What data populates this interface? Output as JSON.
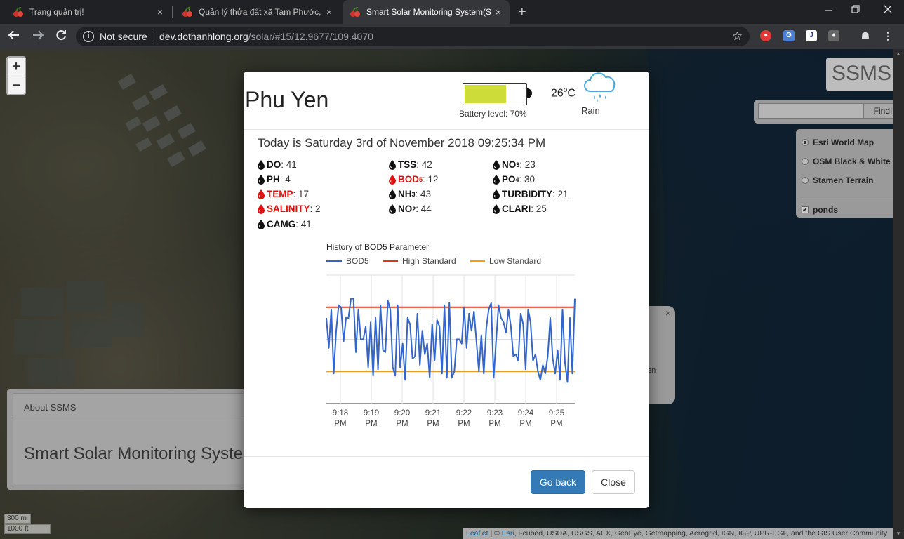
{
  "browser": {
    "tabs": [
      {
        "title": "Trang quản trị!"
      },
      {
        "title": "Quản lý thửa đất xã Tam Phước, I"
      },
      {
        "title": "Smart Solar Monitoring System(S"
      }
    ],
    "security": "Not secure",
    "url_host": "dev.dothanhlong.org",
    "url_path": "/solar/#15/12.9677/109.4070",
    "close_glyph": "×",
    "newtab_glyph": "+"
  },
  "map": {
    "zoom_in": "+",
    "zoom_out": "−",
    "brand": "SSMS",
    "search_button": "Find!",
    "layers": [
      {
        "label": "Esri World Map",
        "selected": true
      },
      {
        "label": "OSM Black & White",
        "selected": false
      },
      {
        "label": "Stamen Terrain",
        "selected": false
      }
    ],
    "overlay_layer": {
      "label": "ponds",
      "checked": true
    },
    "popup_fragment": "en",
    "popup_close": "×",
    "about": {
      "header": "About SSMS",
      "title": "Smart Solar Monitoring System"
    },
    "scale": {
      "metric": "300 m",
      "imperial": "1000 ft"
    },
    "attribution": {
      "leaflet": "Leaflet",
      "sep": " | © ",
      "esri": "Esri",
      "text": ", i-cubed, USDA, USGS, AEX, GeoEye, Getmapping, Aerogrid, IGN, IGP, UPR-EGP, and the GIS User Community"
    }
  },
  "modal": {
    "title": "Phu Yen",
    "battery": {
      "label": "Battery level: 70%",
      "level": 0.7,
      "color": "#cddc39"
    },
    "temperature": "26",
    "temp_unit_sup": "o",
    "temp_unit": "C",
    "weather": "Rain",
    "today": "Today is Saturday 3rd of November 2018 09:25:34 PM",
    "params": [
      {
        "name": "DO",
        "sub": "",
        "value": ": 41",
        "alert": false
      },
      {
        "name": "PH",
        "sub": "",
        "value": ": 4",
        "alert": false
      },
      {
        "name": "TEMP",
        "sub": "",
        "value": ": 17",
        "alert": true
      },
      {
        "name": "SALINITY",
        "sub": "",
        "value": ": 2",
        "alert": true
      },
      {
        "name": "CAMG",
        "sub": "",
        "value": ": 41",
        "alert": false
      },
      {
        "name": "TSS",
        "sub": "",
        "value": ": 42",
        "alert": false
      },
      {
        "name": "BOD",
        "sub": "5",
        "value": ": 12",
        "alert": true
      },
      {
        "name": "NH",
        "sub": "3",
        "value": ": 43",
        "alert": false
      },
      {
        "name": "NO",
        "sub": "2",
        "value": ": 44",
        "alert": false
      },
      {
        "name": "NO",
        "sub": "3",
        "value": ": 23",
        "alert": false
      },
      {
        "name": "PO",
        "sub": "4",
        "value": ": 30",
        "alert": false
      },
      {
        "name": "TURBIDITY",
        "sub": "",
        "value": ": 21",
        "alert": false
      },
      {
        "name": "CLARI",
        "sub": "",
        "value": ": 25",
        "alert": false
      }
    ],
    "go_back": "Go back",
    "close": "Close"
  },
  "chart_data": {
    "type": "line",
    "title": "History of BOD5 Parameter",
    "xlabel": "",
    "ylabel": "",
    "ylim": [
      0,
      60
    ],
    "y_ticks": [
      0,
      15,
      30,
      45,
      60
    ],
    "x_ticks": [
      {
        "line1": "9:18",
        "line2": "PM"
      },
      {
        "line1": "9:19",
        "line2": "PM"
      },
      {
        "line1": "9:20",
        "line2": "PM"
      },
      {
        "line1": "9:21",
        "line2": "PM"
      },
      {
        "line1": "9:22",
        "line2": "PM"
      },
      {
        "line1": "9:23",
        "line2": "PM"
      },
      {
        "line1": "9:24",
        "line2": "PM"
      },
      {
        "line1": "9:25",
        "line2": "PM"
      }
    ],
    "grid": true,
    "legend_position": "top",
    "series": [
      {
        "name": "BOD5",
        "color": "#3366cc",
        "values": [
          40,
          26,
          44,
          14,
          34,
          46,
          45,
          29,
          40,
          40,
          49,
          49,
          24,
          44,
          30,
          30,
          36,
          17,
          38,
          13,
          40,
          16,
          46,
          25,
          24,
          48,
          44,
          17,
          13,
          46,
          17,
          28,
          11,
          40,
          37,
          21,
          22,
          42,
          18,
          34,
          23,
          28,
          12,
          37,
          20,
          39,
          36,
          14,
          46,
          12,
          47,
          12,
          15,
          30,
          30,
          28,
          45,
          26,
          42,
          34,
          43,
          29,
          15,
          32,
          14,
          35,
          44,
          47,
          12,
          29,
          46,
          40,
          38,
          33,
          44,
          36,
          22,
          23,
          20,
          42,
          37,
          16,
          44,
          38,
          20,
          23,
          15,
          11,
          18,
          14,
          22,
          40,
          21,
          14,
          25,
          11,
          44,
          19,
          10,
          40,
          14,
          49
        ]
      },
      {
        "name": "High Standard",
        "color": "#dc3912",
        "values": [
          45
        ]
      },
      {
        "name": "Low Standard",
        "color": "#ff9900",
        "values": [
          15
        ]
      }
    ]
  }
}
